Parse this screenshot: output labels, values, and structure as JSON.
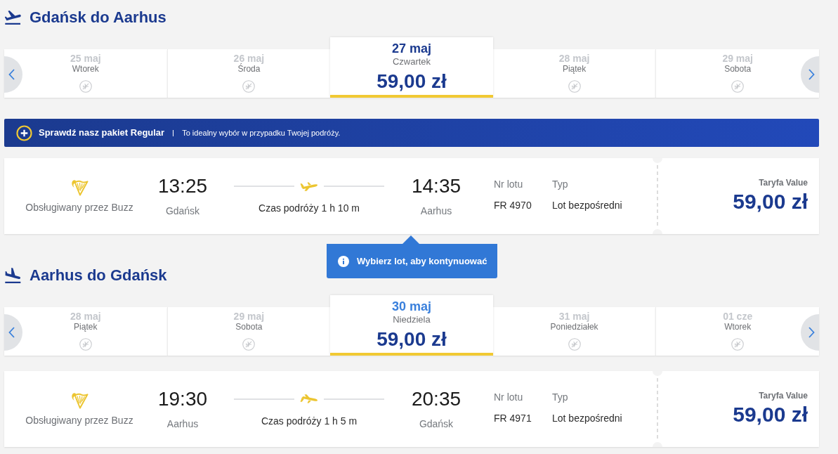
{
  "journeys": [
    {
      "kind": "outbound",
      "title": "Gdańsk do Aarhus",
      "days": [
        {
          "date": "25 maj",
          "weekday": "Wtorek",
          "selected": false,
          "hovered": false
        },
        {
          "date": "26 maj",
          "weekday": "Środa",
          "selected": false,
          "hovered": false
        },
        {
          "date": "27 maj",
          "weekday": "Czwartek",
          "price": "59,00 zł",
          "selected": true,
          "hovered": false
        },
        {
          "date": "28 maj",
          "weekday": "Piątek",
          "selected": false,
          "hovered": false
        },
        {
          "date": "29 maj",
          "weekday": "Sobota",
          "selected": false,
          "hovered": false
        }
      ],
      "promo_banner": {
        "title": "Sprawdź nasz pakiet Regular",
        "text": "To idealny wybór w przypadku Twojej podróży."
      },
      "flights": [
        {
          "operator": "Obsługiwany przez Buzz",
          "departure_time": "13:25",
          "departure_city": "Gdańsk",
          "duration": "Czas podróży 1 h 10 m",
          "arrival_time": "14:35",
          "arrival_city": "Aarhus",
          "flight_number_label": "Nr lotu",
          "flight_number": "FR 4970",
          "type_label": "Typ",
          "type": "Lot bezpośredni",
          "fare_label": "Taryfa Value",
          "price": "59,00 zł"
        }
      ],
      "tooltip": {
        "text": "Wybierz lot, aby kontynuować"
      }
    },
    {
      "kind": "return",
      "title": "Aarhus do Gdańsk",
      "days": [
        {
          "date": "28 maj",
          "weekday": "Piątek",
          "selected": false,
          "hovered": false
        },
        {
          "date": "29 maj",
          "weekday": "Sobota",
          "selected": false,
          "hovered": false
        },
        {
          "date": "30 maj",
          "weekday": "Niedziela",
          "price": "59,00 zł",
          "selected": true,
          "hovered": true
        },
        {
          "date": "31 maj",
          "weekday": "Poniedziałek",
          "selected": false,
          "hovered": false
        },
        {
          "date": "01 cze",
          "weekday": "Wtorek",
          "selected": false,
          "hovered": false
        }
      ],
      "flights": [
        {
          "operator": "Obsługiwany przez Buzz",
          "departure_time": "19:30",
          "departure_city": "Aarhus",
          "duration": "Czas podróży 1 h 5 m",
          "arrival_time": "20:35",
          "arrival_city": "Gdańsk",
          "flight_number_label": "Nr lotu",
          "flight_number": "FR 4971",
          "type_label": "Typ",
          "type": "Lot bezpośredni",
          "fare_label": "Taryfa Value",
          "price": "59,00 zł"
        }
      ]
    }
  ]
}
